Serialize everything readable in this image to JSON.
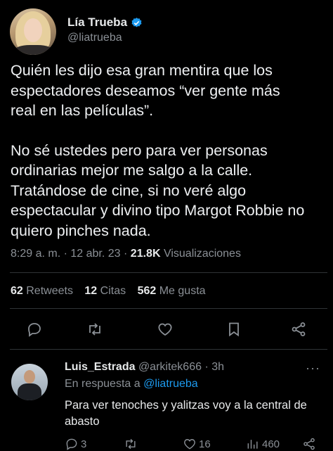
{
  "author": {
    "display_name": "Lía Trueba",
    "handle": "@liatrueba",
    "verified": true
  },
  "tweet": {
    "paragraph1": [
      "Quién les dijo esa gran mentira que los",
      "espectadores deseamos “ver gente más",
      "real en las películas”."
    ],
    "paragraph2": [
      "No sé ustedes pero para ver personas",
      "ordinarias mejor me salgo a la calle.",
      "Tratándose de cine, si no veré algo",
      "espectacular y divino tipo Margot Robbie no",
      "quiero pinches nada."
    ],
    "time": "8:29 a. m.",
    "separator": "·",
    "date": "12 abr. 23",
    "views_count": "21.8K",
    "views_label": "Visualizaciones"
  },
  "stats": {
    "retweets_count": "62",
    "retweets_label": "Retweets",
    "quotes_count": "12",
    "quotes_label": "Citas",
    "likes_count": "562",
    "likes_label": "Me gusta"
  },
  "actions": [
    "reply",
    "retweet",
    "like",
    "bookmark",
    "share"
  ],
  "reply": {
    "display_name": "Luis_Estrada",
    "handle": "@arkitek666",
    "separator": "·",
    "time": "3h",
    "more": "···",
    "reply_to_prefix": "En respuesta a",
    "reply_to_handle": "@liatrueba",
    "text": "Para ver tenoches y yalitzas voy a la central de abasto",
    "replies_count": "3",
    "retweets_count": "",
    "likes_count": "16",
    "views_count": "460"
  },
  "colors": {
    "background": "#000000",
    "text": "#e7e9ea",
    "muted": "#8b9096",
    "accent": "#1d9bf0",
    "divider": "#2f3336"
  }
}
